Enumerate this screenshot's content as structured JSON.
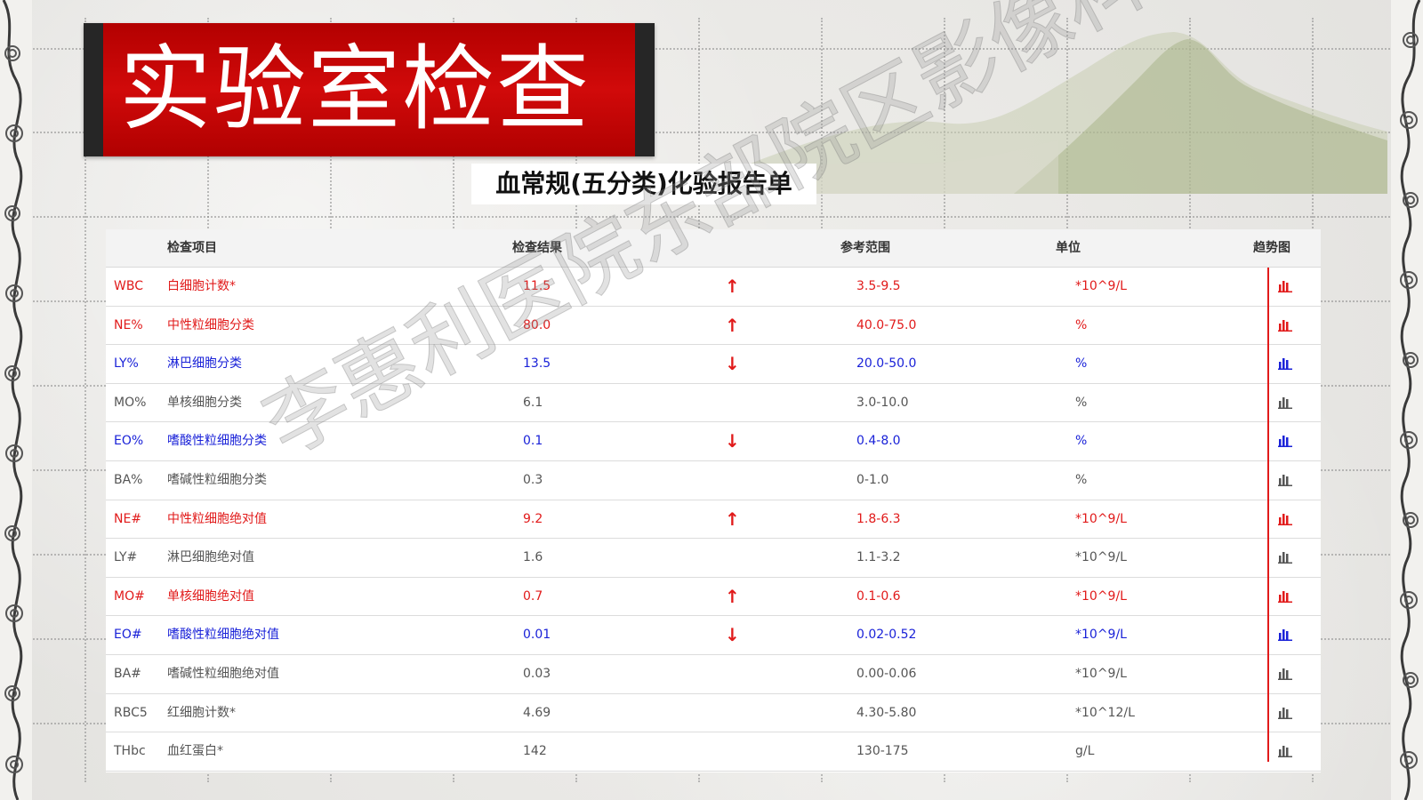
{
  "banner": {
    "title": "实验室检查"
  },
  "report": {
    "title": "血常规(五分类)化验报告单"
  },
  "watermark": "李惠利医院东部院区影像科",
  "colors": {
    "banner_red": "#c10000",
    "high": "#e11a1a",
    "low": "#1a22d8",
    "normal": "#555555"
  },
  "table": {
    "headers": {
      "item": "检查项目",
      "result": "检查结果",
      "ref": "参考范围",
      "unit": "单位",
      "trend": "趋势图"
    },
    "rows": [
      {
        "code": "WBC",
        "name": "白细胞计数*",
        "result": "11.5",
        "arrow": "↑",
        "ref": "3.5-9.5",
        "unit": "*10^9/L",
        "status": "high"
      },
      {
        "code": "NE%",
        "name": "中性粒细胞分类",
        "result": "80.0",
        "arrow": "↑",
        "ref": "40.0-75.0",
        "unit": "%",
        "status": "high"
      },
      {
        "code": "LY%",
        "name": "淋巴细胞分类",
        "result": "13.5",
        "arrow": "↓",
        "ref": "20.0-50.0",
        "unit": "%",
        "status": "low"
      },
      {
        "code": "MO%",
        "name": "单核细胞分类",
        "result": "6.1",
        "arrow": "",
        "ref": "3.0-10.0",
        "unit": "%",
        "status": "normal"
      },
      {
        "code": "EO%",
        "name": "嗜酸性粒细胞分类",
        "result": "0.1",
        "arrow": "↓",
        "ref": "0.4-8.0",
        "unit": "%",
        "status": "low"
      },
      {
        "code": "BA%",
        "name": "嗜碱性粒细胞分类",
        "result": "0.3",
        "arrow": "",
        "ref": "0-1.0",
        "unit": "%",
        "status": "normal"
      },
      {
        "code": "NE#",
        "name": "中性粒细胞绝对值",
        "result": "9.2",
        "arrow": "↑",
        "ref": "1.8-6.3",
        "unit": "*10^9/L",
        "status": "high"
      },
      {
        "code": "LY#",
        "name": "淋巴细胞绝对值",
        "result": "1.6",
        "arrow": "",
        "ref": "1.1-3.2",
        "unit": "*10^9/L",
        "status": "normal"
      },
      {
        "code": "MO#",
        "name": "单核细胞绝对值",
        "result": "0.7",
        "arrow": "↑",
        "ref": "0.1-0.6",
        "unit": "*10^9/L",
        "status": "high"
      },
      {
        "code": "EO#",
        "name": "嗜酸性粒细胞绝对值",
        "result": "0.01",
        "arrow": "↓",
        "ref": "0.02-0.52",
        "unit": "*10^9/L",
        "status": "low"
      },
      {
        "code": "BA#",
        "name": "嗜碱性粒细胞绝对值",
        "result": "0.03",
        "arrow": "",
        "ref": "0.00-0.06",
        "unit": "*10^9/L",
        "status": "normal"
      },
      {
        "code": "RBC5",
        "name": "红细胞计数*",
        "result": "4.69",
        "arrow": "",
        "ref": "4.30-5.80",
        "unit": "*10^12/L",
        "status": "normal"
      },
      {
        "code": "THbc",
        "name": "血红蛋白*",
        "result": "142",
        "arrow": "",
        "ref": "130-175",
        "unit": "g/L",
        "status": "normal"
      }
    ]
  }
}
